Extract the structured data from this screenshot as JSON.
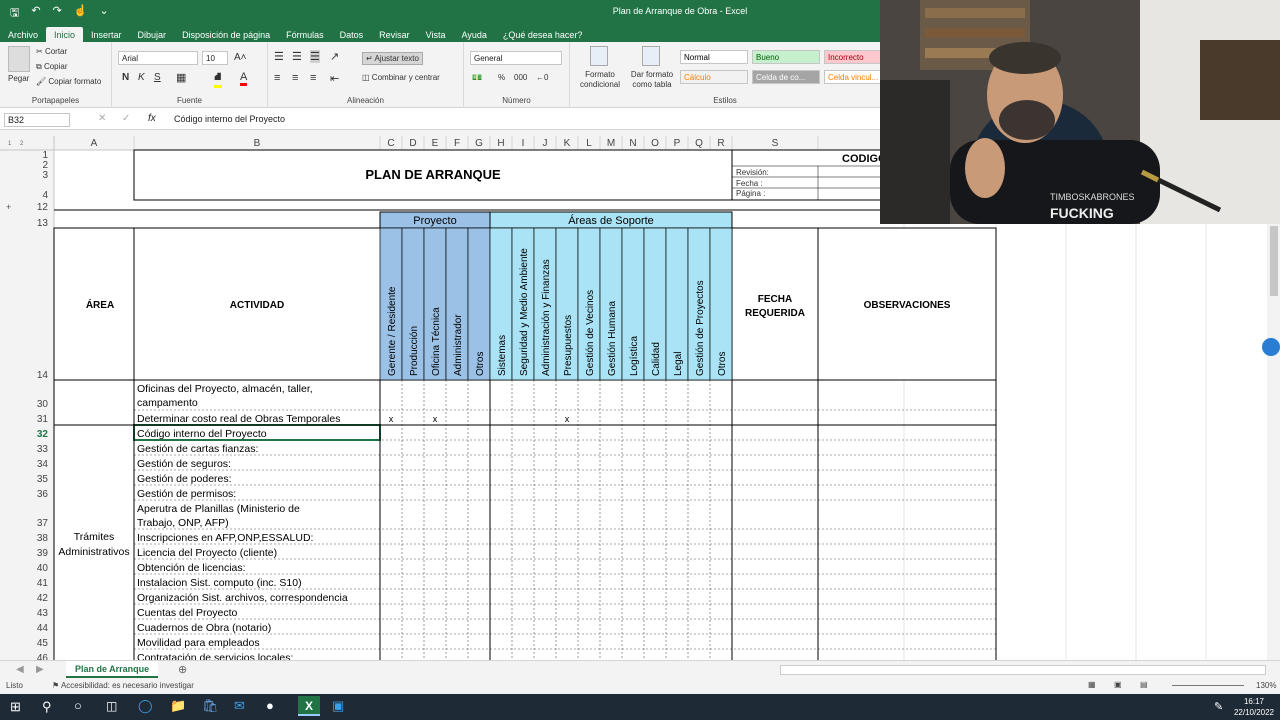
{
  "window": {
    "title": "Plan de Arranque de Obra  -  Excel"
  },
  "ribbon_tabs": [
    "Archivo",
    "Inicio",
    "Insertar",
    "Dibujar",
    "Disposición de página",
    "Fórmulas",
    "Datos",
    "Revisar",
    "Vista",
    "Ayuda",
    "¿Qué desea hacer?"
  ],
  "clipboard": {
    "paste": "Pegar",
    "cut": "Cortar",
    "copy": "Copiar",
    "format_painter": "Copiar formato",
    "label": "Portapapeles"
  },
  "font": {
    "name": "Arial",
    "size": "10",
    "bold": "N",
    "italic": "K",
    "underline": "S",
    "label": "Fuente"
  },
  "alignment": {
    "wrap": "Ajustar texto",
    "merge": "Combinar y centrar",
    "label": "Alineación"
  },
  "number": {
    "format": "General",
    "label": "Número"
  },
  "styles": {
    "conditional": "Formato condicional",
    "as_table": "Dar formato como tabla",
    "label": "Estilos",
    "cells": [
      {
        "name": "Normal",
        "bg": "#ffffff",
        "fg": "#000000"
      },
      {
        "name": "Bueno",
        "bg": "#c6efce",
        "fg": "#006100"
      },
      {
        "name": "Incorrecto",
        "bg": "#ffc7ce",
        "fg": "#9c0006"
      },
      {
        "name": "Cálculo",
        "bg": "#f2f2f2",
        "fg": "#fa7d00"
      },
      {
        "name": "Celda de co...",
        "bg": "#a5a5a5",
        "fg": "#ffffff"
      },
      {
        "name": "Celda vincul...",
        "bg": "#ffffff",
        "fg": "#fa7d00"
      }
    ]
  },
  "formula_bar": {
    "cell": "B32",
    "content": "Código interno del Proyecto",
    "fx": "fx"
  },
  "columns": [
    "A",
    "B",
    "C",
    "D",
    "E",
    "F",
    "G",
    "H",
    "I",
    "J",
    "K",
    "L",
    "M",
    "N",
    "O",
    "P",
    "Q",
    "R",
    "S"
  ],
  "sheet": {
    "title": "PLAN DE ARRANQUE",
    "codigo": "CODIGO",
    "revision": "Revisión:",
    "fecha": "Fecha  :",
    "pagina": "Página :",
    "group_proyecto": "Proyecto",
    "group_soporte": "Áreas de Soporte",
    "header_area": "ÁREA",
    "header_actividad": "ACTIVIDAD",
    "header_fecha": "FECHA REQUERIDA",
    "header_obs": "OBSERVACIONES",
    "roles": [
      "Gerente / Residente",
      "Producción",
      "Oficina Técnica",
      "Administrador",
      "Otros",
      "Sistemas",
      "Seguridad y Medio Ambiente",
      "Administración y Finanzas",
      "Presupuestos",
      "Gestión de Vecinos",
      "Gestión Humana",
      "Logística",
      "Calidad",
      "Legal",
      "Gestión de Proyectos",
      "Otros"
    ],
    "area_tramites": "Trámites Administrativos",
    "rows": [
      {
        "n": "30",
        "act": "Oficinas del Proyecto, almacén, taller, campamento",
        "marks": ""
      },
      {
        "n": "31",
        "act": "Determinar costo real de Obras Temporales",
        "marks": "x"
      },
      {
        "n": "32",
        "act": "Código interno del Proyecto",
        "marks": ""
      },
      {
        "n": "33",
        "act": "Gestión de cartas fianzas:",
        "marks": ""
      },
      {
        "n": "34",
        "act": "Gestión de seguros:",
        "marks": ""
      },
      {
        "n": "35",
        "act": "Gestión de poderes:",
        "marks": ""
      },
      {
        "n": "36",
        "act": "Gestión de permisos:",
        "marks": ""
      },
      {
        "n": "37",
        "act": "Aperutra de Planillas (Ministerio de Trabajo, ONP, AFP)",
        "marks": ""
      },
      {
        "n": "38",
        "act": "Inscripciones en AFP,ONP,ESSALUD:",
        "marks": ""
      },
      {
        "n": "39",
        "act": "Licencia del Proyecto (cliente)",
        "marks": ""
      },
      {
        "n": "40",
        "act": "Obtención de licencias:",
        "marks": ""
      },
      {
        "n": "41",
        "act": "Instalacion Sist. computo (inc. S10)",
        "marks": ""
      },
      {
        "n": "42",
        "act": "Organización Sist. archivos, correspondencia",
        "marks": ""
      },
      {
        "n": "43",
        "act": "Cuentas del Proyecto",
        "marks": ""
      },
      {
        "n": "44",
        "act": "Cuadernos de Obra (notario)",
        "marks": ""
      },
      {
        "n": "45",
        "act": "Movilidad para empleados",
        "marks": ""
      },
      {
        "n": "46",
        "act": "Contratación de servicios locales:",
        "marks": ""
      }
    ]
  },
  "sheet_tab": "Plan de Arranque",
  "status": {
    "ready": "Listo",
    "accessibility": "Accesibilidad: es necesario investigar",
    "zoom": "130%"
  },
  "taskbar": {
    "time": "16:17",
    "date": "22/10/2022"
  },
  "webcam": {
    "shirt_text_1": "TIMBOSKABRONES",
    "shirt_text_2": "FUCKING"
  }
}
